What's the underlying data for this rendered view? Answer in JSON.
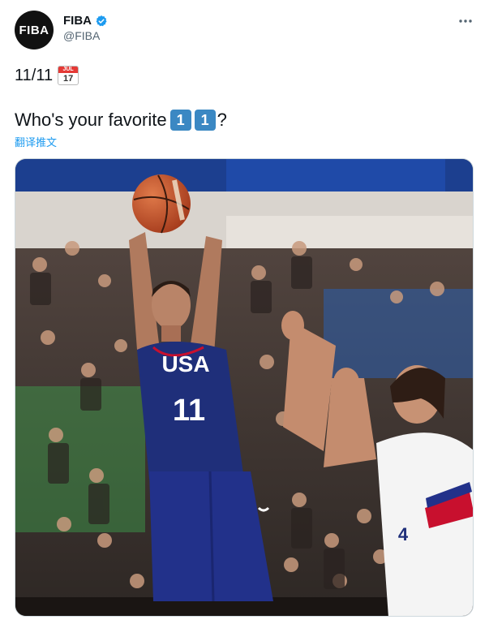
{
  "tweet": {
    "author": {
      "avatar_text": "FIBA",
      "display_name": "FIBA",
      "handle": "@FIBA",
      "verified_icon": "verified-badge-icon",
      "verified_color": "#1d9bf0"
    },
    "more_icon": "ellipsis-icon",
    "line1_text": "11/11",
    "calendar": {
      "month": "JUL",
      "day": "17"
    },
    "line2_text": "Who's your favorite",
    "keycaps": [
      "1",
      "1"
    ],
    "line2_suffix": "?",
    "translate_link": "翻译推文"
  },
  "photo": {
    "description_icon": "basketball-photo",
    "jersey_usa": {
      "team": "USA",
      "number": "11",
      "color": "#1f2f7a"
    },
    "jersey_opponent": {
      "color": "#f4f4f4",
      "number": "4"
    },
    "colors": {
      "arena_blue": "#1c3f8f",
      "crowd_dark": "#3a3330",
      "seats_green": "#3fa34d",
      "ball": "#c8512a"
    }
  }
}
